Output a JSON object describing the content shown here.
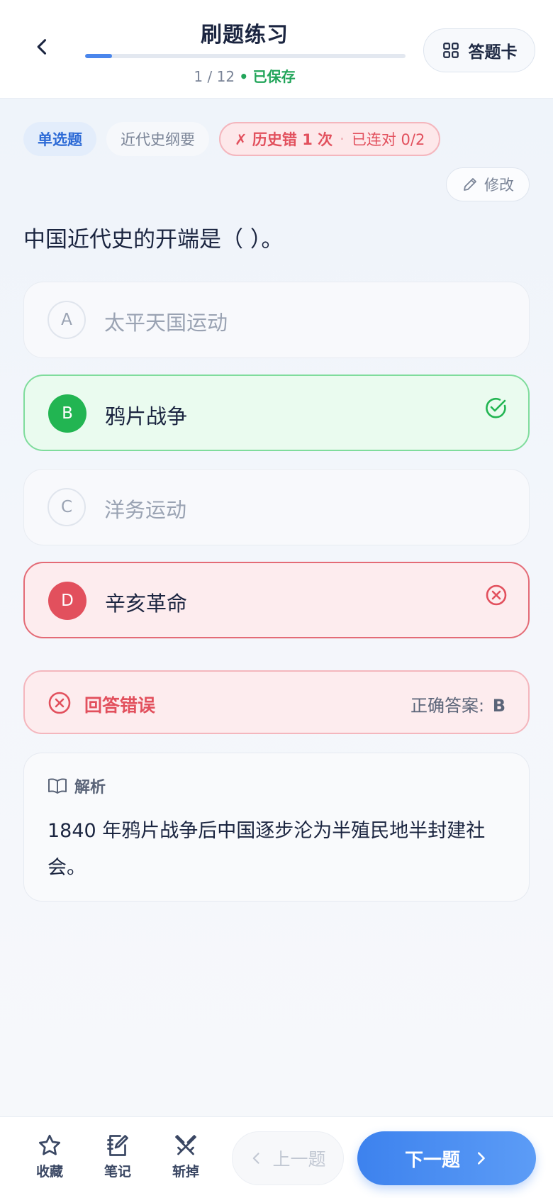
{
  "header": {
    "title": "刷题练习",
    "progress_label": "1 / 12",
    "progress_separator": "•",
    "saved_label": "已保存",
    "progress_fraction": 0.0833,
    "card_button_label": "答题卡"
  },
  "tags": {
    "type": "单选题",
    "subject": "近代史纲要",
    "history_error": "✗ 历史错 1 次",
    "separator": "·",
    "streak": "已连对 0/2"
  },
  "edit_label": "修改",
  "question": "中国近代史的开端是（ ）。",
  "options": [
    {
      "letter": "A",
      "text": "太平天国运动",
      "state": "neutral"
    },
    {
      "letter": "B",
      "text": "鸦片战争",
      "state": "correct"
    },
    {
      "letter": "C",
      "text": "洋务运动",
      "state": "neutral"
    },
    {
      "letter": "D",
      "text": "辛亥革命",
      "state": "wrong"
    }
  ],
  "result": {
    "status": "回答错误",
    "answer_label": "正确答案:",
    "answer_value": "B"
  },
  "analysis": {
    "heading": "解析",
    "body": "1840 年鸦片战争后中国逐步沦为半殖民地半封建社会。"
  },
  "bottom": {
    "favorite_label": "收藏",
    "note_label": "笔记",
    "remove_label": "斩掉",
    "prev_label": "上一题",
    "next_label": "下一题"
  },
  "colors": {
    "accent": "#3d82ee",
    "correct": "#22b552",
    "wrong": "#e2505d",
    "saved": "#22a55a"
  }
}
